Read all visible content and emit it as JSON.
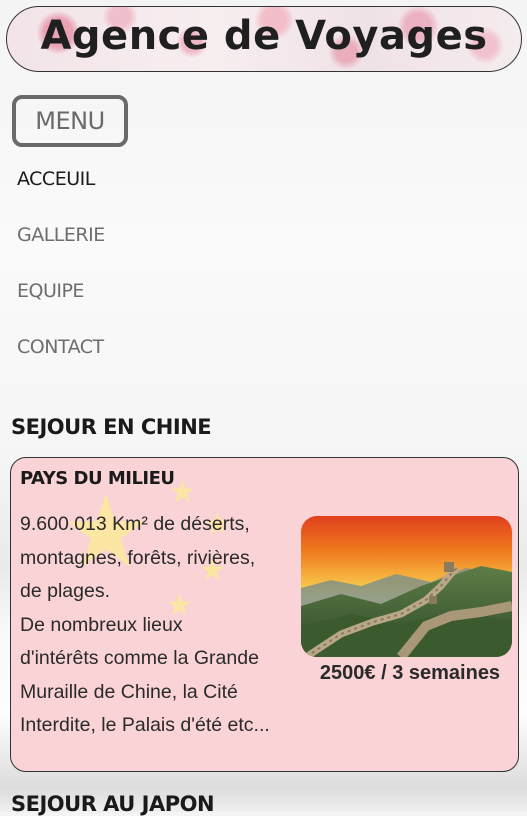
{
  "header": {
    "title": "Agence de Voyages"
  },
  "menu": {
    "label": "MENU"
  },
  "nav": {
    "items": [
      {
        "label": "ACCEUIL",
        "active": true
      },
      {
        "label": "GALLERIE",
        "active": false
      },
      {
        "label": "EQUIPE",
        "active": false
      },
      {
        "label": "CONTACT",
        "active": false
      }
    ]
  },
  "sections": [
    {
      "title": "SEJOUR EN CHINE",
      "card": {
        "title": "PAYS DU MILIEU",
        "text_lines": [
          "9.600.013 Km² de déserts,",
          "montagnes, forêts, rivières,",
          "de plages.",
          "De nombreux lieux",
          "d'intérêts comme la Grande",
          "Muraille de Chine, la Cité",
          "Interdite, le Palais d'été etc..."
        ],
        "price": "2500€ / 3 semaines",
        "colors": {
          "background": "#f9d3d6",
          "stars": "#fbe7a3"
        }
      }
    },
    {
      "title": "SEJOUR AU JAPON"
    }
  ]
}
